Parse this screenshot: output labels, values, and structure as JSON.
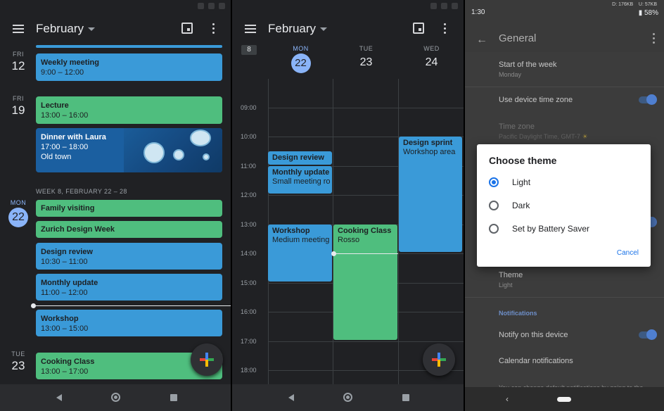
{
  "schedule": {
    "month_title": "February",
    "days": [
      {
        "dow": "FRI",
        "num": "12"
      },
      {
        "dow": "FRI",
        "num": "19"
      },
      {
        "dow": "MON",
        "num": "22"
      },
      {
        "dow": "TUE",
        "num": "23"
      }
    ],
    "week_header": "WEEK 8, FEBRUARY 22 – 28",
    "events": [
      {
        "title": "Weekly meeting",
        "sub": "9:00 – 12:00"
      },
      {
        "title": "Lecture",
        "sub": "13:00 – 16:00"
      },
      {
        "title": "Dinner with Laura",
        "sub": "17:00 – 18:00",
        "loc": "Old town"
      },
      {
        "title": "Family visiting"
      },
      {
        "title": "Zurich Design Week"
      },
      {
        "title": "Design review",
        "sub": "10:30 – 11:00"
      },
      {
        "title": "Monthly update",
        "sub": "11:00 – 12:00"
      },
      {
        "title": "Workshop",
        "sub": "13:00 – 15:00"
      },
      {
        "title": "Cooking Class",
        "sub": "13:00 – 17:00"
      }
    ]
  },
  "threeday": {
    "month_title": "February",
    "week_badge": "8",
    "days": [
      {
        "dow": "MON",
        "num": "22"
      },
      {
        "dow": "TUE",
        "num": "23"
      },
      {
        "dow": "WED",
        "num": "24"
      }
    ],
    "hours": [
      "09:00",
      "10:00",
      "11:00",
      "12:00",
      "13:00",
      "14:00",
      "15:00",
      "16:00",
      "17:00",
      "18:00"
    ],
    "events": [
      {
        "title": "Design review"
      },
      {
        "title": "Monthly update",
        "sub": "Small meeting ro"
      },
      {
        "title": "Workshop",
        "sub": "Medium meeting"
      },
      {
        "title": "Cooking Class",
        "sub": "Rosso"
      },
      {
        "title": "Design sprint",
        "sub": "Workshop area"
      }
    ]
  },
  "settings": {
    "status_time": "1:30",
    "net_down": "D: 176KB",
    "net_up": "U: 57KB",
    "battery": "58%",
    "title": "General",
    "items": [
      {
        "label": "Start of the week",
        "value": "Monday"
      },
      {
        "label": "Use device time zone"
      },
      {
        "label": "Time zone",
        "value": "Pacific Daylight Time, GMT-7"
      },
      {
        "label": "Theme",
        "value": "Light"
      },
      {
        "label": "Notify on this device"
      },
      {
        "label": "Calendar notifications"
      },
      {
        "label": "You can change default notifications by going to the"
      }
    ],
    "section_notifications": "Notifications",
    "dialog": {
      "title": "Choose theme",
      "options": [
        "Light",
        "Dark",
        "Set by Battery Saver"
      ],
      "selected": "Light",
      "cancel": "Cancel"
    }
  },
  "colors": {
    "event_blue": "#3a9ad8",
    "event_green": "#4fbe7e",
    "today_accent": "#8ab4f8",
    "dialog_accent": "#1a73e8"
  }
}
